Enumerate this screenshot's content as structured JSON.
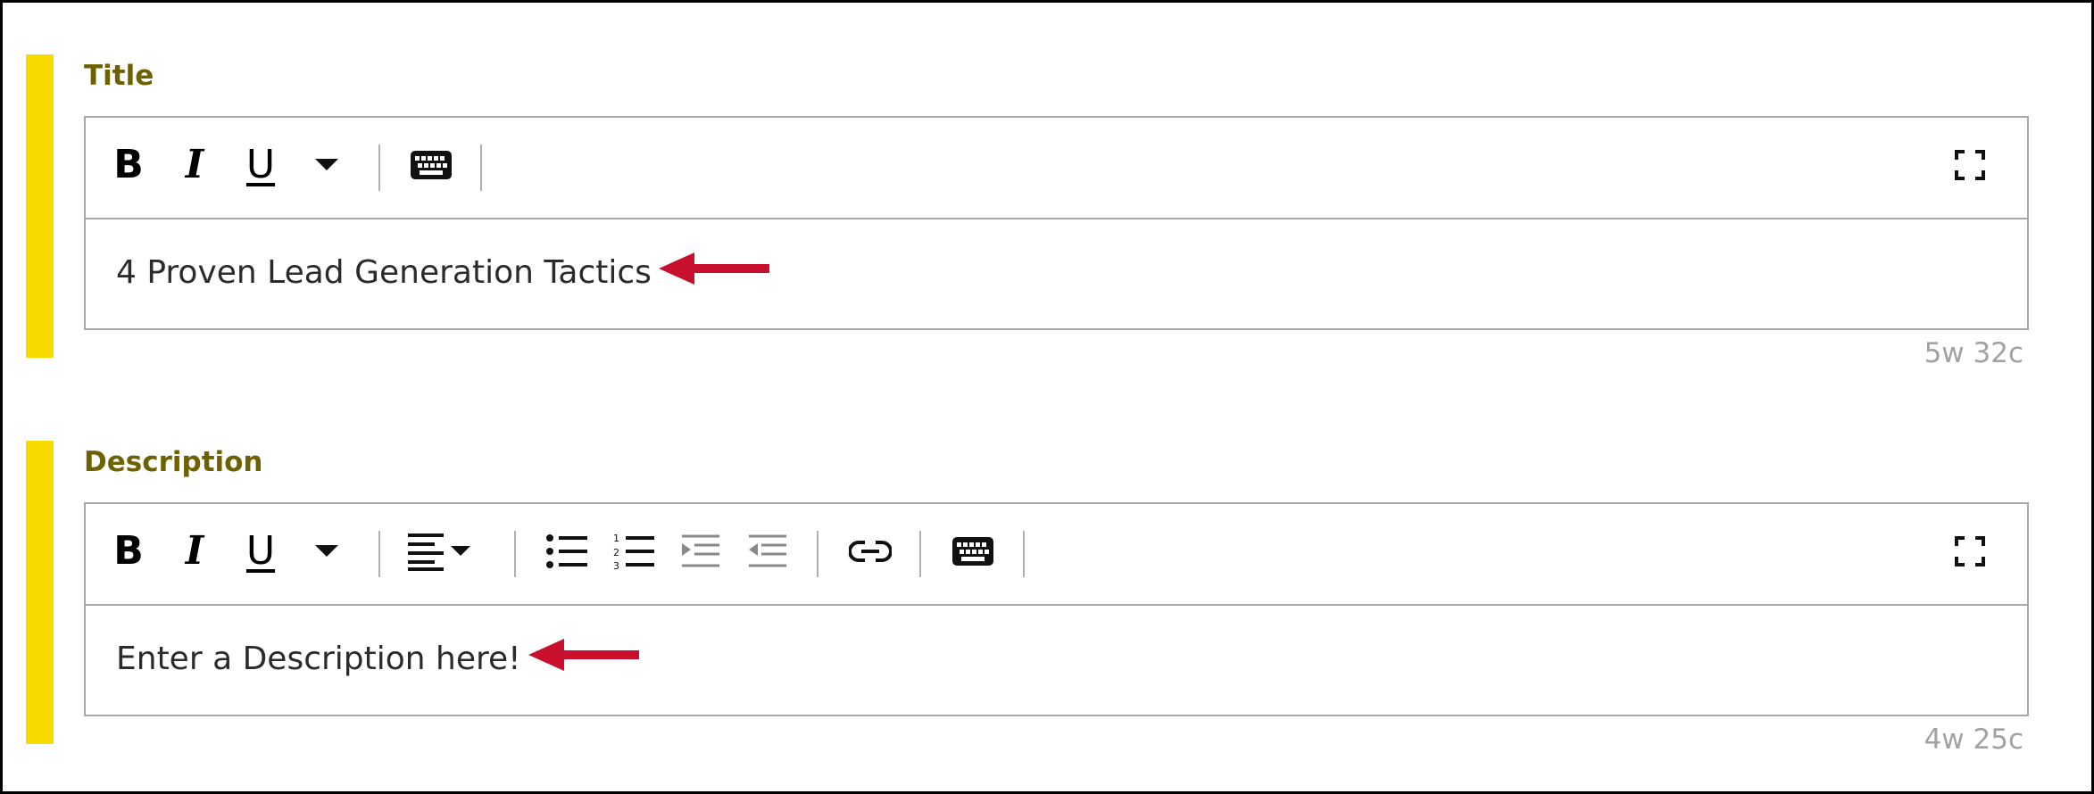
{
  "title_field": {
    "label": "Title",
    "value": "4 Proven Lead Generation Tactics",
    "count": "5w 32c",
    "toolbar": {
      "bold": "B",
      "italic": "I",
      "underline": "U",
      "icons": [
        "chevron-down-icon",
        "keyboard-icon",
        "fullscreen-icon"
      ]
    }
  },
  "description_field": {
    "label": "Description",
    "value": "Enter a Description here!",
    "count": "4w 25c",
    "toolbar": {
      "bold": "B",
      "italic": "I",
      "underline": "U",
      "icons": [
        "chevron-down-icon",
        "align-left-icon",
        "bullet-list-icon",
        "numbered-list-icon",
        "indent-icon",
        "outdent-icon",
        "link-icon",
        "keyboard-icon",
        "fullscreen-icon"
      ]
    }
  },
  "colors": {
    "accent_bar": "#f5db00",
    "label_text": "#6e6200",
    "arrow": "#c8102e",
    "border": "#a8a8a8",
    "count_text": "#a2a2a2"
  }
}
